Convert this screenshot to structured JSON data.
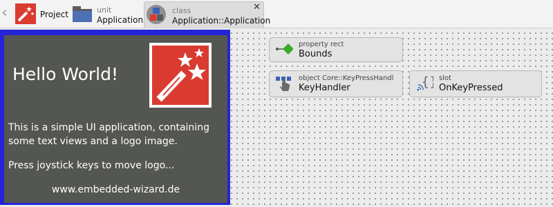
{
  "breadcrumb": {
    "project": {
      "label": "Project"
    },
    "unit": {
      "type": "unit",
      "label": "Application"
    },
    "class": {
      "type": "class",
      "label": "Application::Application",
      "close": "✕"
    }
  },
  "preview": {
    "hello": "Hello World!",
    "description": "This is a simple UI application, containing some text views and a logo image.",
    "hint": "Press joystick keys to move logo...",
    "url": "www.embedded-wizard.de"
  },
  "nodes": {
    "bounds": {
      "type": "property rect",
      "name": "Bounds"
    },
    "keyhandler": {
      "type": "object Core::KeyPressHandler",
      "name": "KeyHandler"
    },
    "slot": {
      "type": "slot",
      "name": "OnKeyPressed"
    }
  },
  "colors": {
    "brand_red": "#d93b31",
    "preview_bg": "#545651",
    "selection": "#2424d6",
    "property_green": "#3aaa2a",
    "handler_blue": "#3b63b8"
  },
  "icons": {
    "project": "magic-wand-icon",
    "unit": "folder-icon",
    "class": "class-icon",
    "property": "property-diamond-icon",
    "keyhandler": "hand-pointer-icon",
    "slot": "slot-braces-icon"
  }
}
